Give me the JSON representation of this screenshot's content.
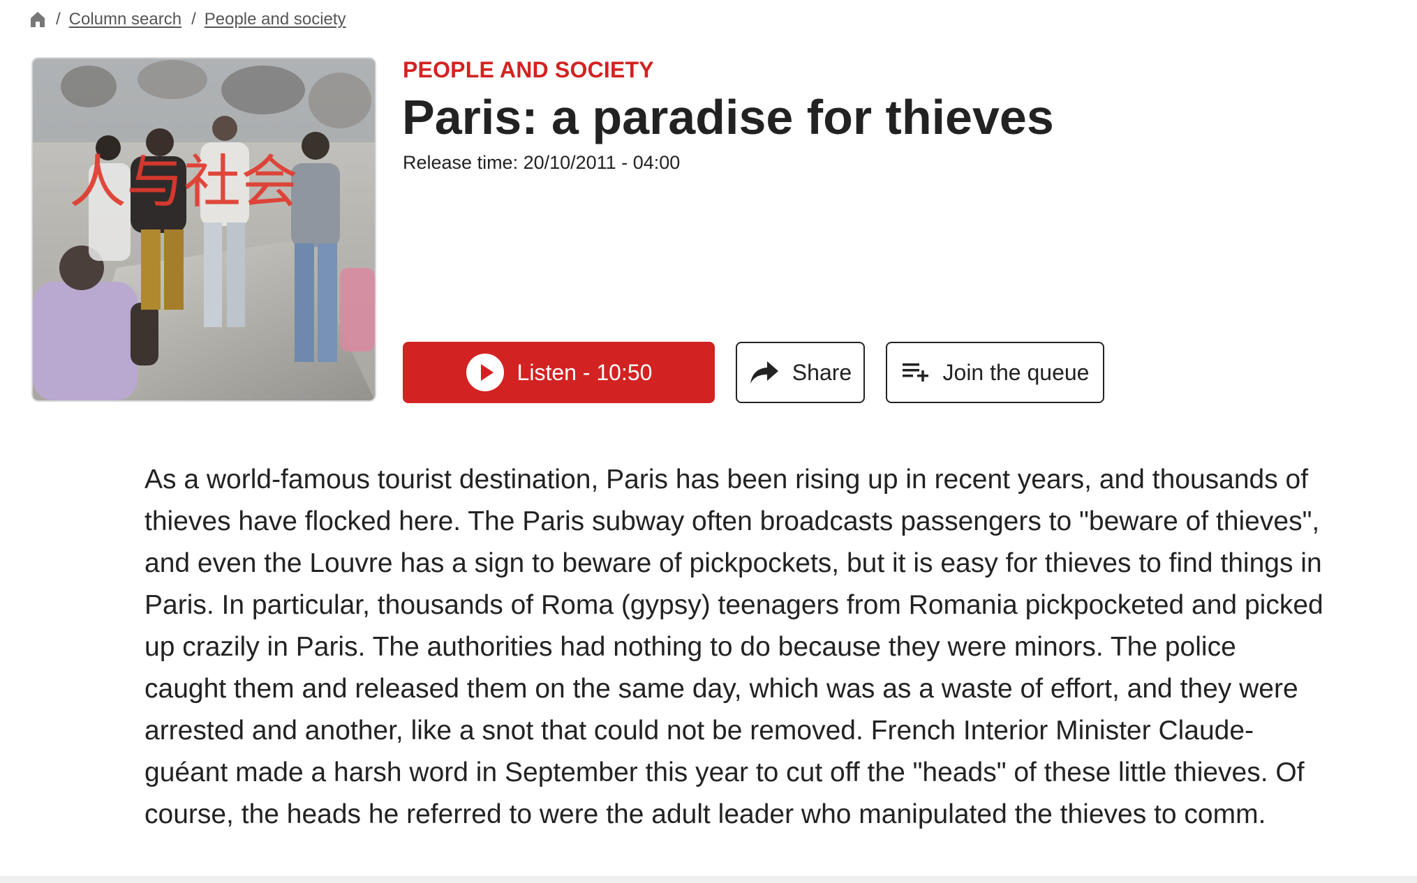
{
  "breadcrumb": {
    "home_icon": "home-icon",
    "items": [
      {
        "label": "Column search"
      },
      {
        "label": "People and society"
      }
    ]
  },
  "cover": {
    "overlay_text": "人与社会"
  },
  "header": {
    "category": "PEOPLE AND SOCIETY",
    "title": "Paris: a paradise for thieves",
    "release": "Release time: 20/10/2011 - 04:00"
  },
  "actions": {
    "listen_label": "Listen - 10:50",
    "share_label": "Share",
    "queue_label": "Join the queue"
  },
  "article": {
    "body": "As a world-famous tourist destination, Paris has been rising up in recent years, and thousands of thieves have flocked here. The Paris subway often broadcasts passengers to \"beware of thieves\", and even the Louvre has a sign to beware of pickpockets, but it is easy for thieves to find things in Paris. In particular, thousands of Roma (gypsy) teenagers from Romania pickpocketed and picked up crazily in Paris. The authorities had nothing to do because they were minors. The police caught them and released them on the same day, which was as a waste of effort, and they were arrested and another, like a snot that could not be removed. French Interior Minister Claude-guéant made a harsh word in September this year to cut off the \"heads\" of these little thieves. Of course, the heads he referred to were the adult leader who manipulated the thieves to comm."
  },
  "colors": {
    "accent": "#d32222",
    "text": "#222222",
    "muted": "#555555"
  }
}
